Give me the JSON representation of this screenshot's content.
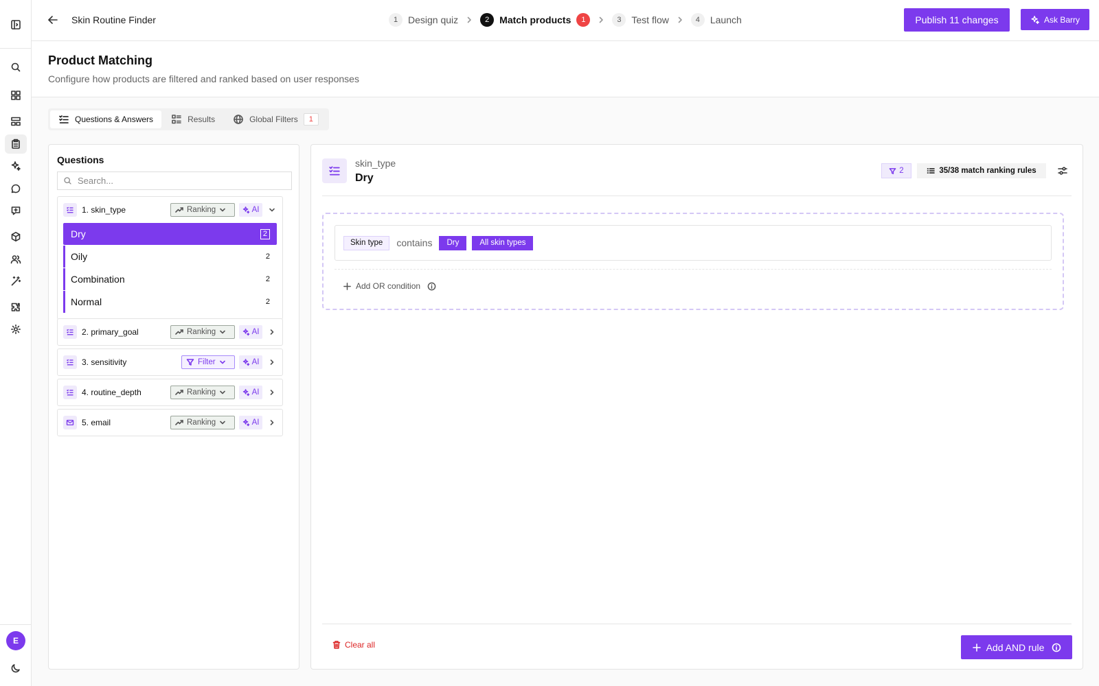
{
  "header": {
    "app_title": "Skin Routine Finder",
    "steps": [
      {
        "num": "1",
        "label": "Design quiz"
      },
      {
        "num": "2",
        "label": "Match products",
        "badge": "1"
      },
      {
        "num": "3",
        "label": "Test flow"
      },
      {
        "num": "4",
        "label": "Launch"
      }
    ],
    "publish_label": "Publish 11 changes",
    "ask_label": "Ask Barry"
  },
  "page": {
    "title": "Product Matching",
    "subtitle": "Configure how products are filtered and ranked based on user responses"
  },
  "tabs": [
    {
      "label": "Questions & Answers",
      "icon": "list-check-icon"
    },
    {
      "label": "Results",
      "icon": "list-grid-icon"
    },
    {
      "label": "Global Filters",
      "icon": "globe-icon",
      "count": "1"
    }
  ],
  "questions_panel": {
    "title": "Questions",
    "search_placeholder": "Search...",
    "questions": [
      {
        "label": "1. skin_type",
        "mode": "Ranking",
        "ai": "AI",
        "icon": "list-check-icon",
        "answers": [
          {
            "label": "Dry",
            "count": "2"
          },
          {
            "label": "Oily",
            "count": "2"
          },
          {
            "label": "Combination",
            "count": "2"
          },
          {
            "label": "Normal",
            "count": "2"
          }
        ]
      },
      {
        "label": "2. primary_goal",
        "mode": "Ranking",
        "ai": "AI",
        "icon": "list-check-icon"
      },
      {
        "label": "3. sensitivity",
        "mode": "Filter",
        "ai": "AI",
        "icon": "list-check-icon"
      },
      {
        "label": "4. routine_depth",
        "mode": "Ranking",
        "ai": "AI",
        "icon": "list-check-icon"
      },
      {
        "label": "5. email",
        "mode": "Ranking",
        "ai": "AI",
        "icon": "mail-icon"
      }
    ]
  },
  "main": {
    "question_key": "skin_type",
    "answer_name": "Dry",
    "filter_count": "2",
    "ranking_rules": "35/38 match ranking rules",
    "condition": {
      "field": "Skin type",
      "operator": "contains",
      "values": [
        "Dry",
        "All skin types"
      ]
    },
    "add_or_label": "Add OR condition",
    "clear_all_label": "Clear all",
    "add_and_label": "Add AND rule"
  },
  "colors": {
    "accent": "#7c3aed",
    "danger": "#ef4444"
  }
}
